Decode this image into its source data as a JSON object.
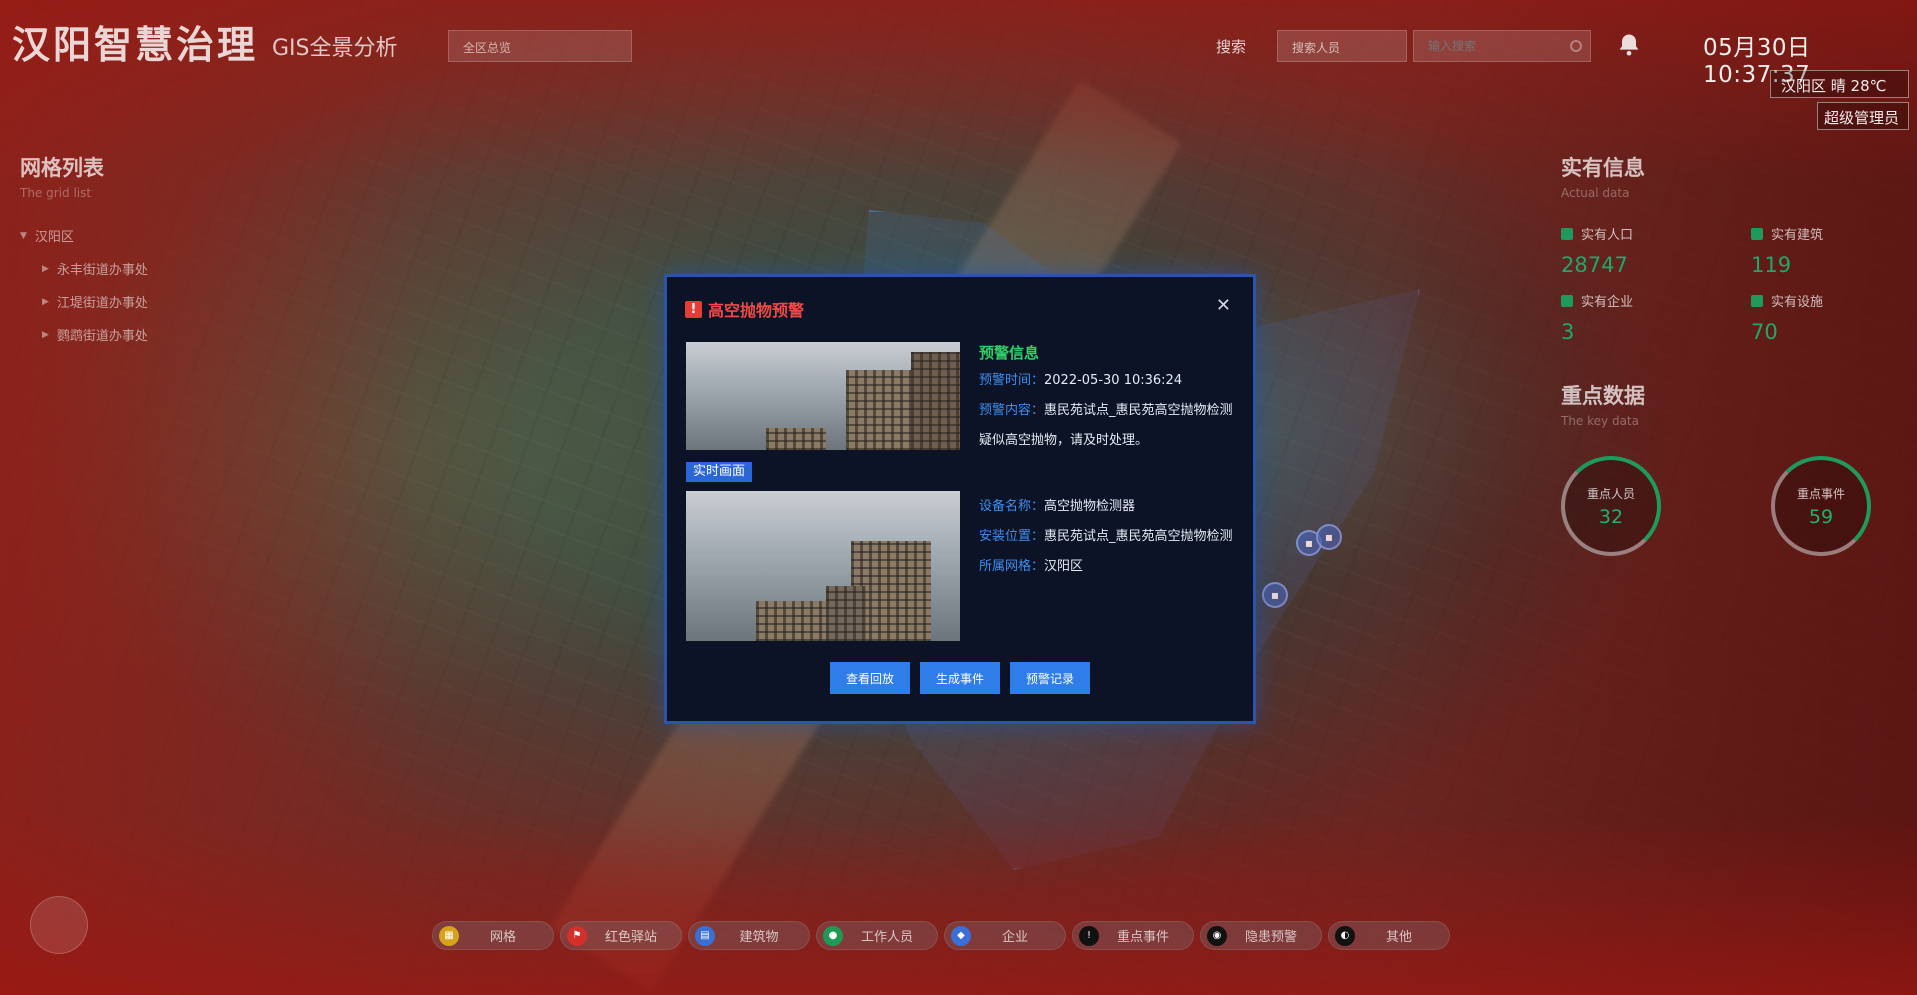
{
  "header": {
    "title": "汉阳智慧治理",
    "subtitle": "GIS全景分析",
    "area_select": "全区总览",
    "search_label": "搜索",
    "search_type": "搜索人员",
    "search_placeholder": "输入搜索",
    "clock": "05月30日 10:37:37",
    "weather": "汉阳区  晴  28℃",
    "role": "超级管理员"
  },
  "grid_panel": {
    "title": "网格列表",
    "subtitle": "The grid list",
    "root": "汉阳区",
    "children": [
      "永丰街道办事处",
      "江堤街道办事处",
      "鹦鹉街道办事处"
    ]
  },
  "actual_panel": {
    "title": "实有信息",
    "subtitle": "Actual data",
    "stats": [
      {
        "label": "实有人口",
        "value": "28747"
      },
      {
        "label": "实有建筑",
        "value": "119"
      },
      {
        "label": "实有企业",
        "value": "3"
      },
      {
        "label": "实有设施",
        "value": "70"
      }
    ]
  },
  "key_panel": {
    "title": "重点数据",
    "subtitle": "The key data",
    "rings": [
      {
        "label": "重点人员",
        "value": "32"
      },
      {
        "label": "重点事件",
        "value": "59"
      }
    ]
  },
  "layers": [
    {
      "label": "网格",
      "icon": "grid-icon",
      "color": "#d6a21c"
    },
    {
      "label": "红色驿站",
      "icon": "flag-icon",
      "color": "#d3302a"
    },
    {
      "label": "建筑物",
      "icon": "building-icon",
      "color": "#3b6fd6"
    },
    {
      "label": "工作人员",
      "icon": "person-icon",
      "color": "#1f9a55"
    },
    {
      "label": "企业",
      "icon": "enterprise-icon",
      "color": "#3b6fd6"
    },
    {
      "label": "重点事件",
      "icon": "alert-icon",
      "color": "#111111"
    },
    {
      "label": "隐患预警",
      "icon": "iot-icon",
      "color": "#111111"
    },
    {
      "label": "其他",
      "icon": "other-icon",
      "color": "#111111"
    }
  ],
  "modal": {
    "title": "高空抛物预警",
    "live_tag": "实时画面",
    "info_heading": "预警信息",
    "alert_time_key": "预警时间：",
    "alert_time": "2022-05-30 10:36:24",
    "alert_content_key": "预警内容：",
    "alert_content": "惠民苑试点_惠民苑高空抛物检测 疑似高空抛物，请及时处理。",
    "device_name_key": "设备名称：",
    "device_name": "高空抛物检测器",
    "install_loc_key": "安装位置：",
    "install_loc": "惠民苑试点_惠民苑高空抛物检测",
    "grid_key": "所属网格：",
    "grid": "汉阳区",
    "buttons": [
      "查看回放",
      "生成事件",
      "预警记录"
    ]
  },
  "colors": {
    "accent_blue": "#2f7de8",
    "alert_red": "#f04a44",
    "stat_green": "#1fa86a"
  }
}
